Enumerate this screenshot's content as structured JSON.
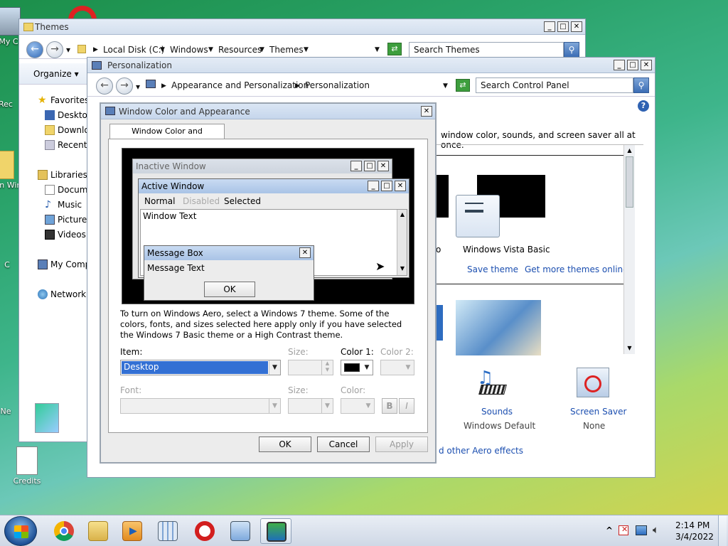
{
  "desktop": {
    "icons": [
      "My C",
      "Rec",
      "Win Win",
      "C",
      "Ne",
      "Credits"
    ]
  },
  "themes_window": {
    "title": "Themes",
    "breadcrumb": [
      "Local Disk (C:)",
      "Windows",
      "Resources",
      "Themes"
    ],
    "search_placeholder": "Search Themes",
    "organize": "Organize",
    "nav": {
      "favorites": "Favorites",
      "desktop": "Desktop",
      "downloads": "Downlo",
      "recent": "Recent",
      "libraries": "Libraries",
      "documents": "Docum",
      "music": "Music",
      "pictures": "Picture",
      "videos": "Videos",
      "computer": "My Comp",
      "network": "Network"
    }
  },
  "personalization_window": {
    "title": "Personalization",
    "breadcrumb": [
      "Appearance and Personalization",
      "Personalization"
    ],
    "search_placeholder": "Search Control Panel",
    "intro_text": "window color, sounds, and screen saver all at once.",
    "theme_partial_label": "o",
    "theme_name": "Windows Vista Basic",
    "save_theme": "Save theme",
    "get_more_themes": "Get more themes online",
    "sounds_label": "Sounds",
    "sounds_value": "Windows Default",
    "screensaver_label": "Screen Saver",
    "screensaver_value": "None",
    "aero_link": "d other Aero effects"
  },
  "dialog": {
    "title": "Window Color and Appearance",
    "tab": "Window Color and Appearance",
    "preview": {
      "inactive_title": "Inactive Window",
      "active_title": "Active Window",
      "menu_normal": "Normal",
      "menu_disabled": "Disabled",
      "menu_selected": "Selected",
      "window_text": "Window Text",
      "msg_title": "Message Box",
      "msg_text": "Message Text",
      "msg_ok": "OK"
    },
    "info_text": "To turn on Windows Aero, select a Windows 7 theme.  Some of the colors, fonts, and sizes selected here apply only if you have selected the Windows 7 Basic theme or a High Contrast theme.",
    "item_label": "Item:",
    "item_value": "Desktop",
    "size_label": "Size:",
    "color1_label": "Color 1:",
    "color1_value": "#000000",
    "color2_label": "Color 2:",
    "font_label": "Font:",
    "font_size_label": "Size:",
    "font_color_label": "Color:",
    "bold": "B",
    "italic": "I",
    "ok": "OK",
    "cancel": "Cancel",
    "apply": "Apply"
  },
  "taskbar": {
    "time": "2:14 PM",
    "date": "3/4/2022",
    "tray_expand": "^"
  }
}
